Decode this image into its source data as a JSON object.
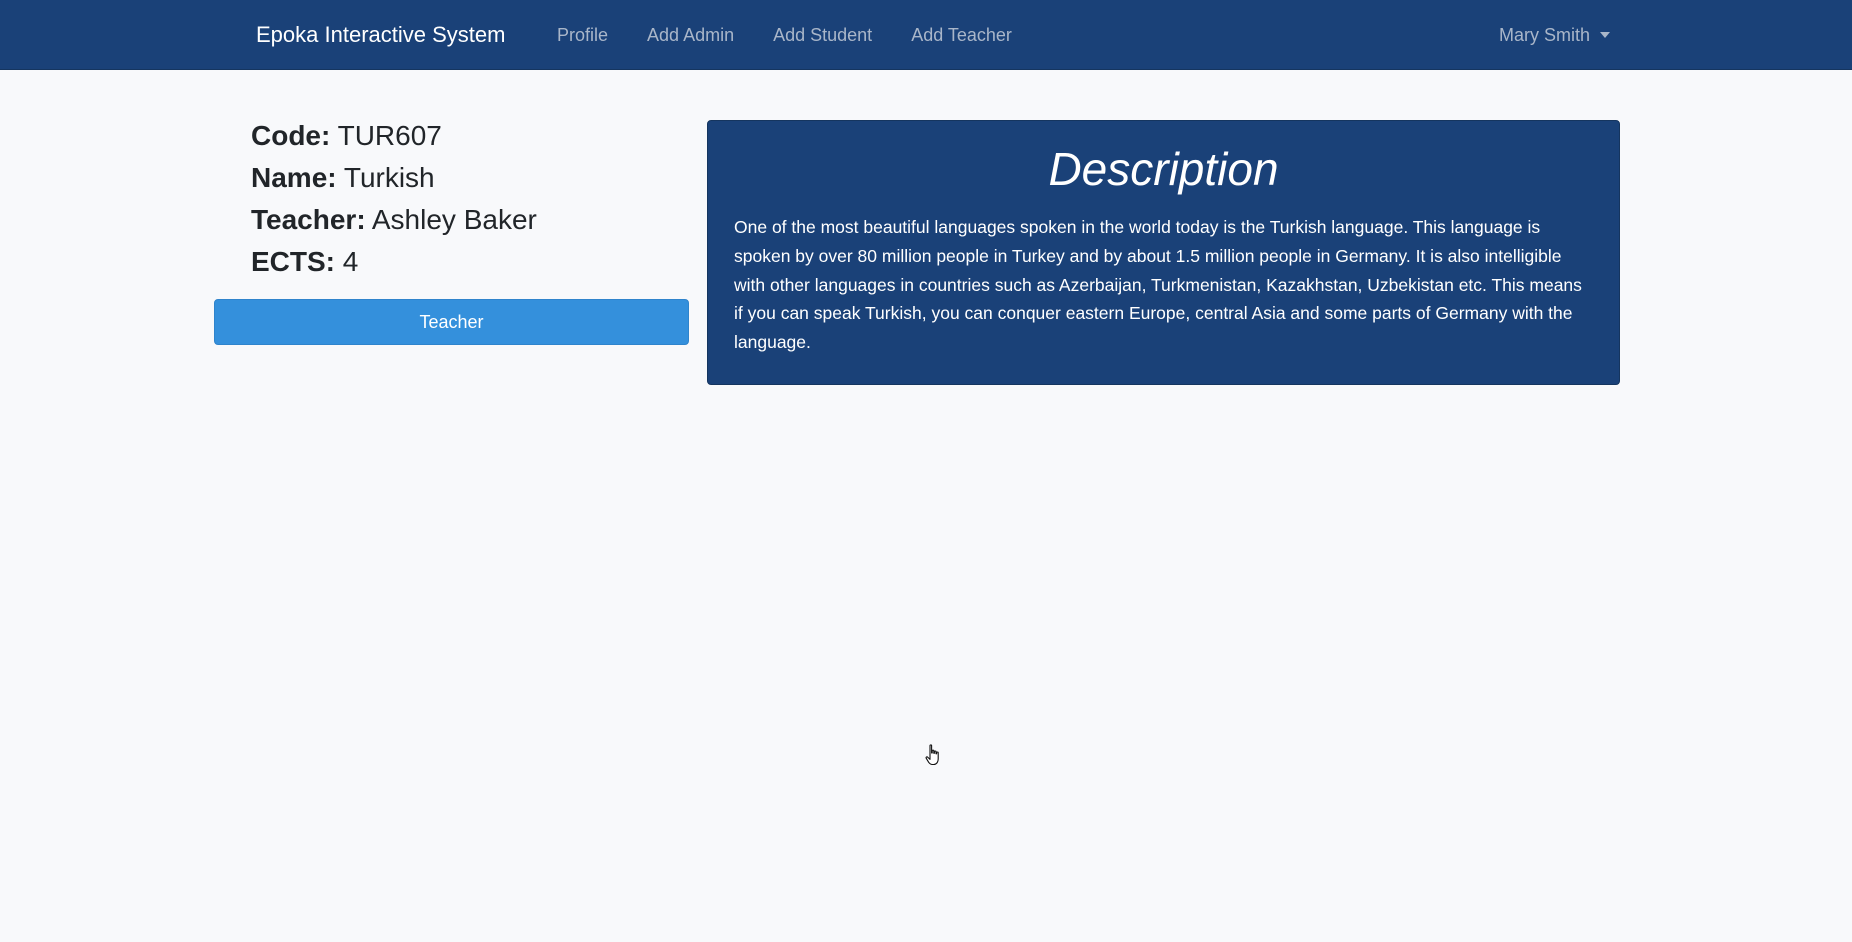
{
  "navbar": {
    "brand": "Epoka Interactive System",
    "links": [
      "Profile",
      "Add Admin",
      "Add Student",
      "Add Teacher"
    ],
    "user": "Mary Smith"
  },
  "course": {
    "code_label": "Code:",
    "code": "TUR607",
    "name_label": "Name:",
    "name": "Turkish",
    "teacher_label": "Teacher:",
    "teacher": "Ashley Baker",
    "ects_label": "ECTS:",
    "ects": "4"
  },
  "teacher_button": "Teacher",
  "description": {
    "title": "Description",
    "text": "One of the most beautiful languages spoken in the world today is the Turkish language. This language is spoken by over 80 million people in Turkey and by about 1.5 million people in Germany. It is also intelligible with other languages in countries such as Azerbaijan, Turkmenistan, Kazakhstan, Uzbekistan etc. This means if you can speak Turkish, you can conquer eastern Europe, central Asia and some parts of Germany with the language."
  },
  "colors": {
    "navbar": "#1a4178",
    "button": "#3490dc",
    "background": "#f8f9fb"
  }
}
